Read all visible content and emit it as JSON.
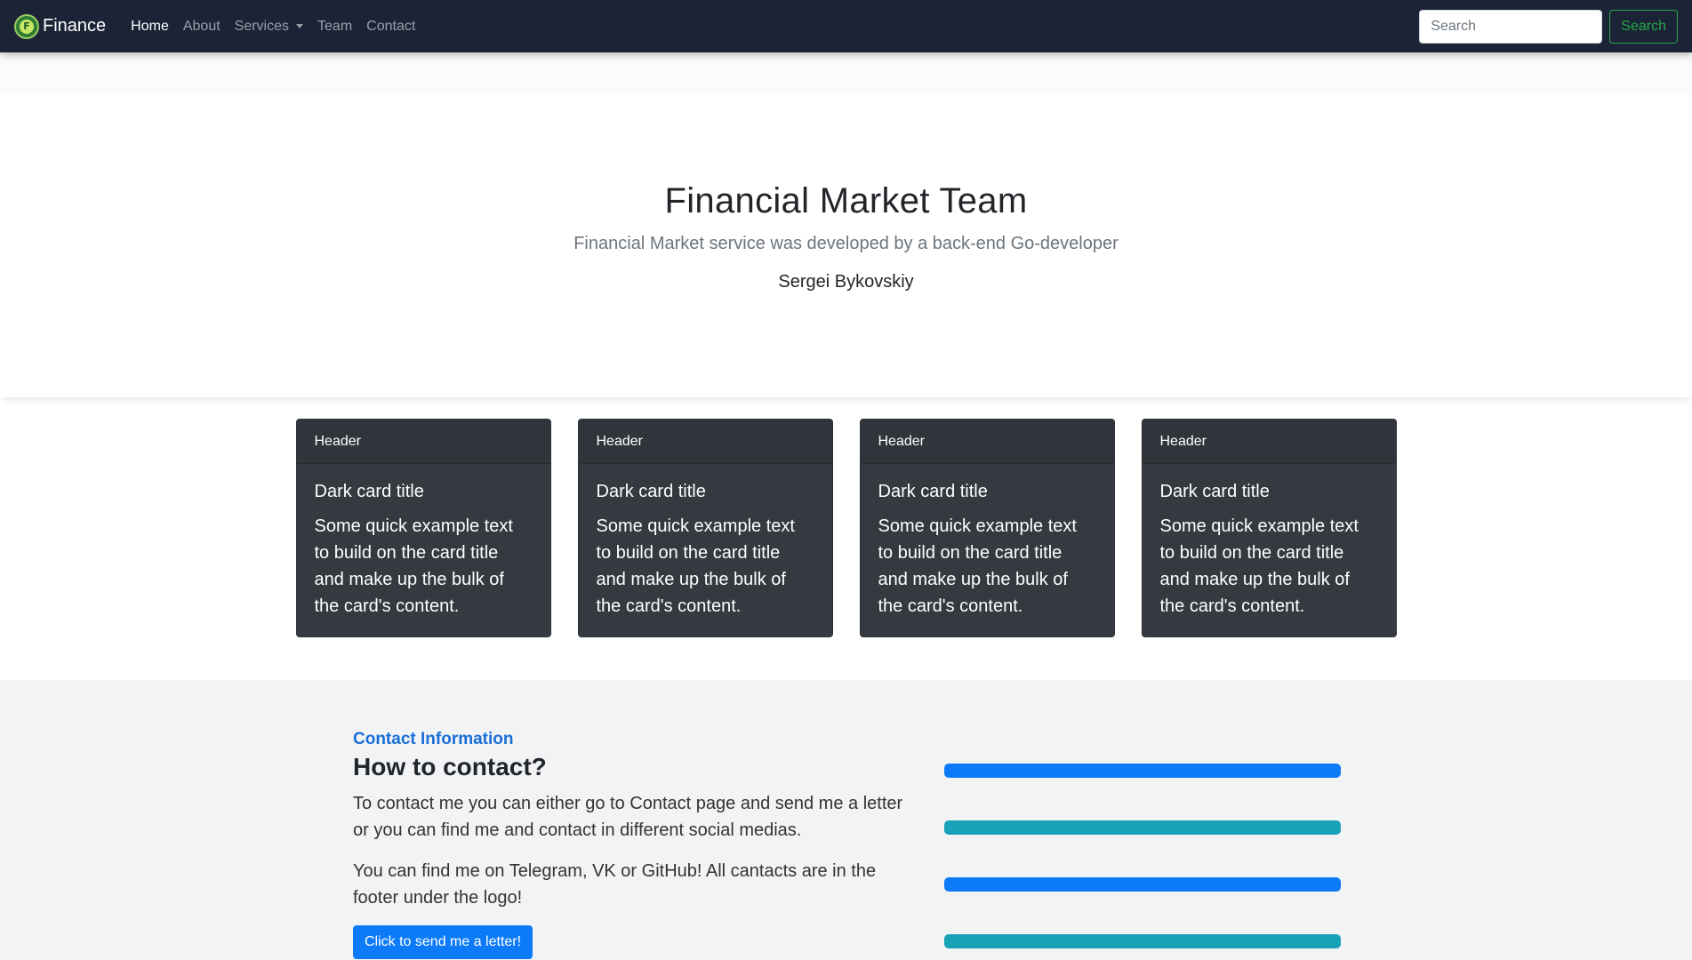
{
  "navbar": {
    "brand": "Finance",
    "brand_logo_letter": "F",
    "links": [
      {
        "label": "Home",
        "active": true
      },
      {
        "label": "About",
        "active": false
      },
      {
        "label": "Services",
        "active": false,
        "dropdown": true
      },
      {
        "label": "Team",
        "active": false
      },
      {
        "label": "Contact",
        "active": false
      }
    ],
    "search": {
      "placeholder": "Search",
      "button_label": "Search"
    }
  },
  "hero": {
    "title": "Financial Market Team",
    "subtitle": "Financial Market service was developed by a back-end Go-developer",
    "author": "Sergei Bykovskiy"
  },
  "cards": [
    {
      "header": "Header",
      "title": "Dark card title",
      "text": "Some quick example text to build on the card title and make up the bulk of the card's content."
    },
    {
      "header": "Header",
      "title": "Dark card title",
      "text": "Some quick example text to build on the card title and make up the bulk of the card's content."
    },
    {
      "header": "Header",
      "title": "Dark card title",
      "text": "Some quick example text to build on the card title and make up the bulk of the card's content."
    },
    {
      "header": "Header",
      "title": "Dark card title",
      "text": "Some quick example text to build on the card title and make up the bulk of the card's content."
    }
  ],
  "contact": {
    "kicker": "Contact Information",
    "heading": "How to contact?",
    "paragraph1": "To contact me you can either go to Contact page and send me a letter or you can find me and contact in different social medias.",
    "paragraph2": "You can find me on Telegram, VK or GitHub! All cantacts are in the footer under the logo!",
    "button_label": "Click to send me a letter!",
    "bars": [
      {
        "color": "#0d7bf8",
        "progress": 1.0
      },
      {
        "color": "#17a2b8",
        "progress": 1.0
      },
      {
        "color": "#0d7bf8",
        "progress": 1.0
      },
      {
        "color": "#17a2b8",
        "progress": 1.0
      }
    ]
  },
  "colors": {
    "navbar_bg": "#1b2437",
    "card_bg": "#343a40",
    "primary": "#0d7bf8",
    "info": "#17a2b8",
    "success": "#28a745",
    "contact_bg": "#f2f3f5"
  }
}
